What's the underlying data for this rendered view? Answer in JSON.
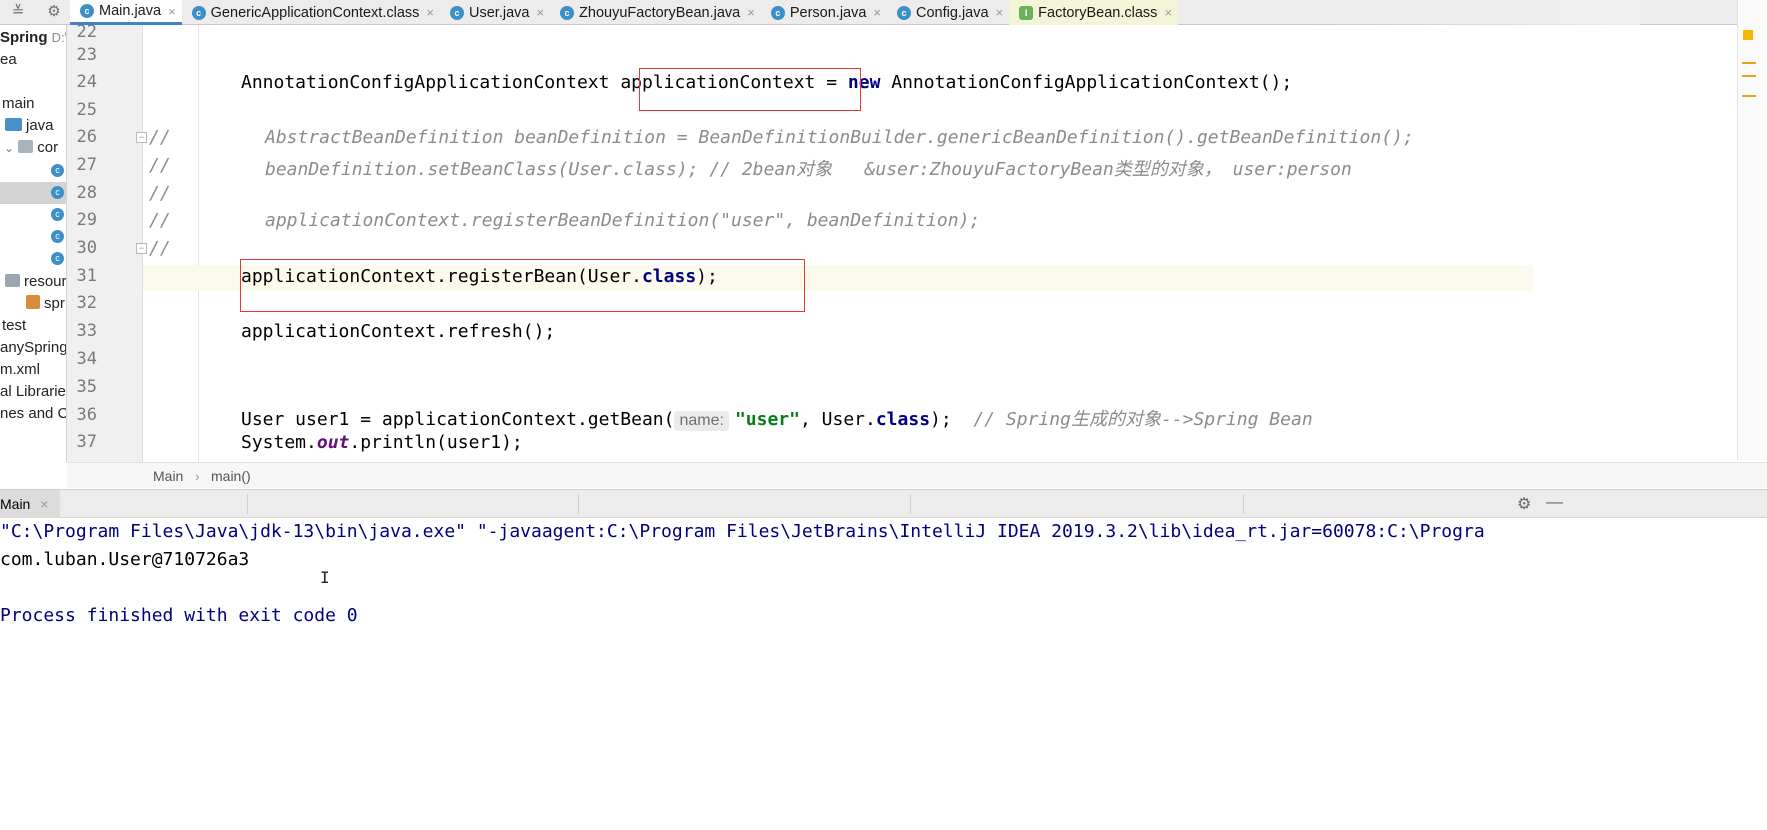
{
  "tabs": [
    {
      "label": "Main.java",
      "icon": "class-icon",
      "active": true
    },
    {
      "label": "GenericApplicationContext.class",
      "icon": "class-icon"
    },
    {
      "label": "User.java",
      "icon": "class-icon"
    },
    {
      "label": "ZhouyuFactoryBean.java",
      "icon": "class-icon"
    },
    {
      "label": "Person.java",
      "icon": "class-icon"
    },
    {
      "label": "Config.java",
      "icon": "class-icon"
    },
    {
      "label": "FactoryBean.class",
      "icon": "interface-icon"
    }
  ],
  "tab_close_glyph": "×",
  "sidebar": {
    "project": "Spring",
    "path": "D:\\",
    "items": [
      "ea",
      "main",
      "java",
      "cor",
      "resour",
      "spr",
      "test",
      "anySpring.i",
      "m.xml",
      "al Libraries",
      "nes and Co"
    ]
  },
  "editor": {
    "line_numbers": [
      "22",
      "23",
      "24",
      "25",
      "26",
      "27",
      "28",
      "29",
      "30",
      "31",
      "32",
      "33",
      "34",
      "35",
      "36",
      "37"
    ],
    "line24": {
      "type": "AnnotationConfigApplicationContext",
      "var": "applicationContext",
      "eq": " = ",
      "kw_new": "new",
      "ctor": " AnnotationConfigApplicationContext();"
    },
    "line26": {
      "prefix": "//",
      "body": "AbstractBeanDefinition beanDefinition = BeanDefinitionBuilder.genericBeanDefinition().getBeanDefinition();"
    },
    "line27": {
      "prefix": "//",
      "body": "beanDefinition.setBeanClass(User.class); // 2bean对象   &user:ZhouyuFactoryBean类型的对象， user:person"
    },
    "line28": {
      "prefix": "//"
    },
    "line29": {
      "prefix": "//",
      "body": "applicationContext.registerBeanDefinition(\"user\", beanDefinition);"
    },
    "line30": {
      "prefix": "//"
    },
    "line31": {
      "pre": "applicationContext.registerBean(User.",
      "kw": "class",
      "post": ");"
    },
    "line33": {
      "text": "applicationContext.refresh();"
    },
    "line36": {
      "pre": "User user1 = applicationContext.getBean(",
      "hint": "name:",
      "str": "\"user\"",
      "mid": ", User.",
      "kw": "class",
      "post": ");",
      "comment": "// Spring生成的对象-->Spring Bean"
    },
    "line37": {
      "pre": "System.",
      "field": "out",
      "post": ".println(user1);"
    }
  },
  "breadcrumb": {
    "items": [
      "Main",
      "main()"
    ],
    "separator": "›"
  },
  "run": {
    "tab_label": "Main",
    "lines": [
      "\"C:\\Program Files\\Java\\jdk-13\\bin\\java.exe\" \"-javaagent:C:\\Program Files\\JetBrains\\IntelliJ IDEA 2019.3.2\\lib\\idea_rt.jar=60078:C:\\Progra",
      "com.luban.User@710726a3",
      "",
      "Process finished with exit code 0"
    ]
  },
  "colors": {
    "accent": "#4083c9",
    "highlight_box": "#e53935",
    "keyword": "#000080",
    "string": "#067d17",
    "comment": "#8c8c8c"
  }
}
